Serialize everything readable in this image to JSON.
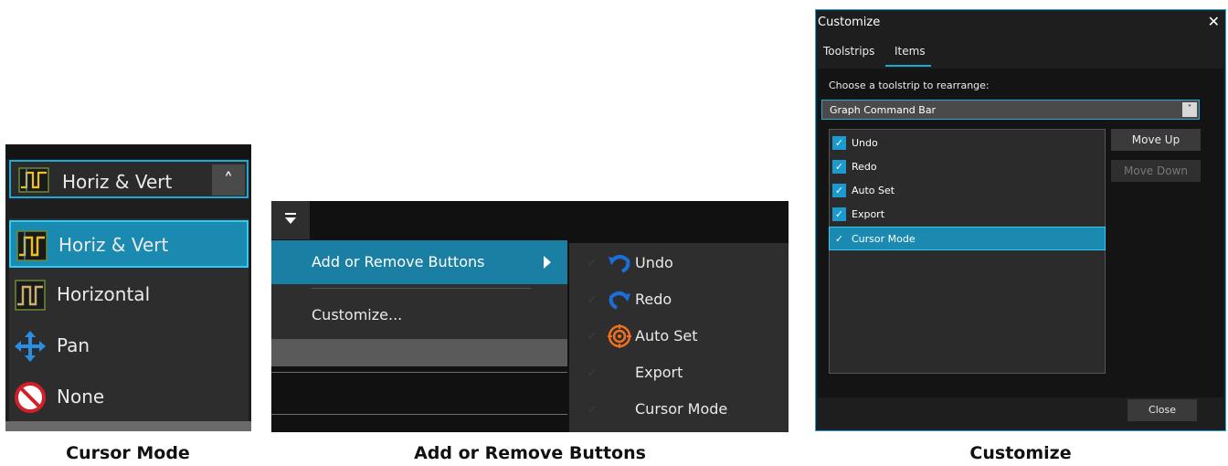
{
  "cursor_mode": {
    "caption": "Cursor Mode",
    "combo": {
      "label": "Horiz & Vert"
    },
    "items": [
      {
        "label": "Horiz & Vert",
        "icon": "horiz-vert-cursor-icon",
        "selected": true
      },
      {
        "label": "Horizontal",
        "icon": "horizontal-cursor-icon",
        "selected": false
      },
      {
        "label": "Pan",
        "icon": "pan-arrows-icon",
        "selected": false
      },
      {
        "label": "None",
        "icon": "no-entry-icon",
        "selected": false
      }
    ],
    "colors": {
      "accent": "#1fa9d6",
      "selected_bg": "#1b8ab0"
    }
  },
  "add_remove": {
    "caption": "Add or Remove Buttons",
    "menu": {
      "add_remove_label": "Add or Remove Buttons",
      "customize_label": "Customize..."
    },
    "submenu": [
      {
        "label": "Undo",
        "icon": "undo-icon",
        "checked": true
      },
      {
        "label": "Redo",
        "icon": "redo-icon",
        "checked": true
      },
      {
        "label": "Auto Set",
        "icon": "auto-set-target-icon",
        "checked": true
      },
      {
        "label": "Export",
        "icon": "",
        "checked": true
      },
      {
        "label": "Cursor Mode",
        "icon": "",
        "checked": true
      }
    ]
  },
  "customize": {
    "caption": "Customize",
    "title": "Customize",
    "tabs": [
      "Toolstrips",
      "Items"
    ],
    "active_tab": "Items",
    "prompt": "Choose a toolstrip to rearrange:",
    "selected_toolstrip": "Graph Command Bar",
    "items": [
      {
        "label": "Undo",
        "checked": true
      },
      {
        "label": "Redo",
        "checked": true
      },
      {
        "label": "Auto Set",
        "checked": true
      },
      {
        "label": "Export",
        "checked": true
      },
      {
        "label": "Cursor Mode",
        "checked": true,
        "selected": true
      }
    ],
    "buttons": {
      "move_up": "Move Up",
      "move_down": "Move Down",
      "close": "Close"
    }
  }
}
